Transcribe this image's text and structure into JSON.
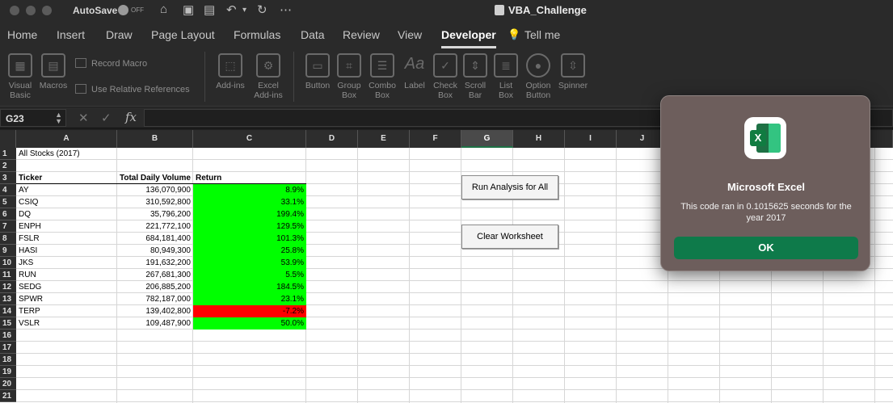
{
  "window": {
    "autosave_label": "AutoSave",
    "autosave_state": "OFF",
    "title": "VBA_Challenge"
  },
  "tabs": [
    "Home",
    "Insert",
    "Draw",
    "Page Layout",
    "Formulas",
    "Data",
    "Review",
    "View",
    "Developer",
    "Tell me"
  ],
  "active_tab": "Developer",
  "ribbon": {
    "visual_basic": "Visual Basic",
    "macros": "Macros",
    "record_macro": "Record Macro",
    "use_relative": "Use Relative References",
    "addins": "Add-ins",
    "excel_addins": "Excel Add-ins",
    "controls": [
      "Button",
      "Group Box",
      "Combo Box",
      "Label",
      "Check Box",
      "Scroll Bar",
      "List Box",
      "Option Button",
      "Spinner"
    ]
  },
  "formula_bar": {
    "name_box": "G23",
    "fx": "fx",
    "content": ""
  },
  "sheet": {
    "columns": [
      "A",
      "B",
      "C",
      "D",
      "E",
      "F",
      "G",
      "H",
      "I",
      "J"
    ],
    "selected_column": "G",
    "rows": [
      "1",
      "2",
      "3",
      "4",
      "5",
      "6",
      "7",
      "8",
      "9",
      "10",
      "11",
      "12",
      "13",
      "14",
      "15",
      "16",
      "17",
      "18",
      "19",
      "20",
      "21"
    ],
    "title": "All Stocks (2017)",
    "headers": [
      "Ticker",
      "Total Daily Volume",
      "Return"
    ],
    "data": [
      {
        "ticker": "AY",
        "volume": "136,070,900",
        "ret": "8.9%",
        "positive": true
      },
      {
        "ticker": "CSIQ",
        "volume": "310,592,800",
        "ret": "33.1%",
        "positive": true
      },
      {
        "ticker": "DQ",
        "volume": "35,796,200",
        "ret": "199.4%",
        "positive": true
      },
      {
        "ticker": "ENPH",
        "volume": "221,772,100",
        "ret": "129.5%",
        "positive": true
      },
      {
        "ticker": "FSLR",
        "volume": "684,181,400",
        "ret": "101.3%",
        "positive": true
      },
      {
        "ticker": "HASI",
        "volume": "80,949,300",
        "ret": "25.8%",
        "positive": true
      },
      {
        "ticker": "JKS",
        "volume": "191,632,200",
        "ret": "53.9%",
        "positive": true
      },
      {
        "ticker": "RUN",
        "volume": "267,681,300",
        "ret": "5.5%",
        "positive": true
      },
      {
        "ticker": "SEDG",
        "volume": "206,885,200",
        "ret": "184.5%",
        "positive": true
      },
      {
        "ticker": "SPWR",
        "volume": "782,187,000",
        "ret": "23.1%",
        "positive": true
      },
      {
        "ticker": "TERP",
        "volume": "139,402,800",
        "ret": "-7.2%",
        "positive": false
      },
      {
        "ticker": "VSLR",
        "volume": "109,487,900",
        "ret": "50.0%",
        "positive": true
      }
    ],
    "buttons": {
      "run_all": "Run Analysis for All",
      "clear": "Clear Worksheet"
    }
  },
  "dialog": {
    "title": "Microsoft Excel",
    "message": "This code ran in 0.1015625 seconds for the year 2017",
    "ok": "OK"
  },
  "colors": {
    "positive": "#00ff00",
    "negative": "#ff0000",
    "ok_button": "#0e7a4a"
  }
}
